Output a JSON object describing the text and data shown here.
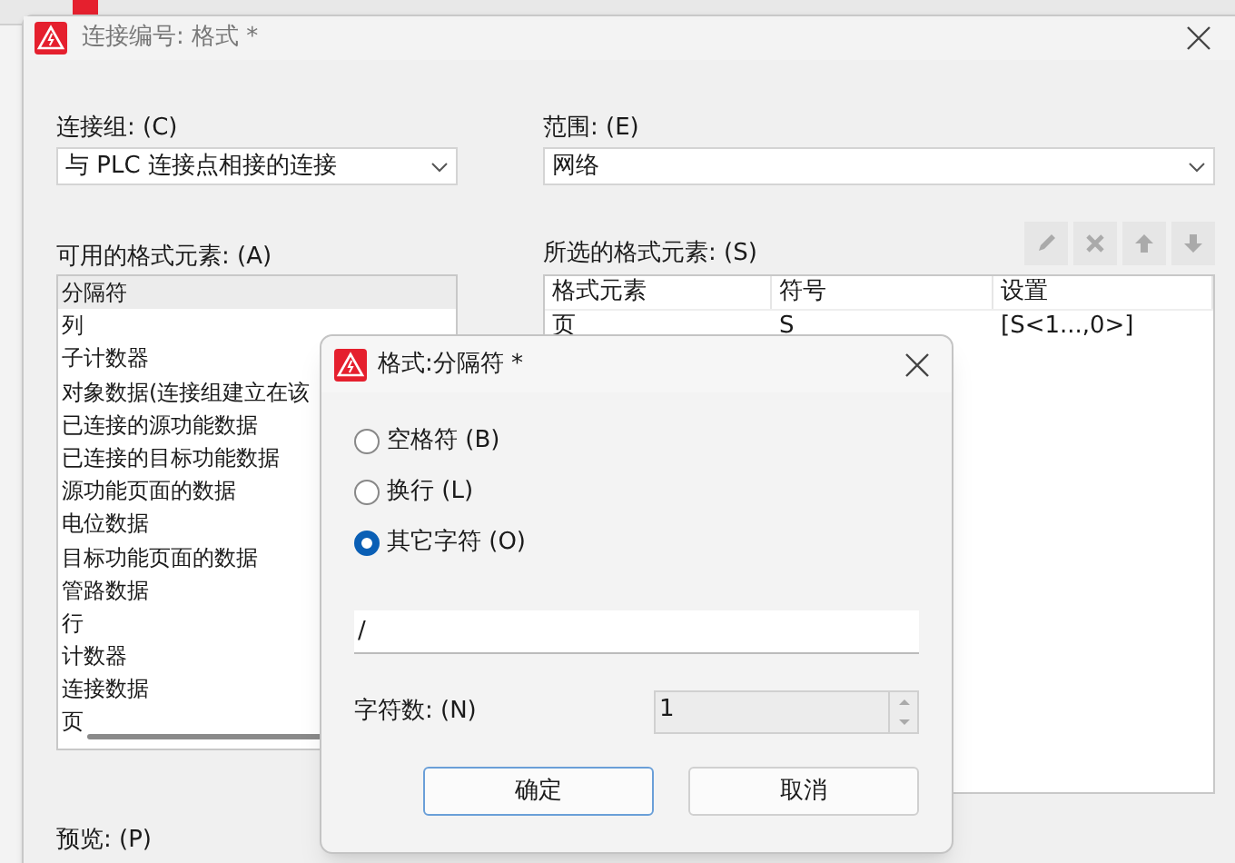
{
  "window": {
    "title": "连接编号: 格式 *"
  },
  "connection_group": {
    "label": "连接组: (C)",
    "value": "与 PLC 连接点相接的连接"
  },
  "scope": {
    "label": "范围: (E)",
    "value": "网络"
  },
  "available": {
    "label": "可用的格式元素: (A)",
    "items": [
      {
        "text": "分隔符",
        "selected": true
      },
      {
        "text": "列",
        "selected": false
      },
      {
        "text": "子计数器",
        "selected": false
      },
      {
        "text": "对象数据(连接组建立在该",
        "selected": false
      },
      {
        "text": "已连接的源功能数据",
        "selected": false
      },
      {
        "text": "已连接的目标功能数据",
        "selected": false
      },
      {
        "text": "源功能页面的数据",
        "selected": false
      },
      {
        "text": "电位数据",
        "selected": false
      },
      {
        "text": "目标功能页面的数据",
        "selected": false
      },
      {
        "text": "管路数据",
        "selected": false
      },
      {
        "text": "行",
        "selected": false
      },
      {
        "text": "计数器",
        "selected": false
      },
      {
        "text": "连接数据",
        "selected": false
      },
      {
        "text": "页",
        "selected": false
      }
    ]
  },
  "selected_elements": {
    "label": "所选的格式元素: (S)",
    "columns": [
      "格式元素",
      "符号",
      "设置"
    ],
    "rows": [
      [
        "页",
        "S",
        "[S<1...,0>]"
      ]
    ]
  },
  "preview": {
    "label": "预览: (P)"
  },
  "dialog": {
    "title": "格式:分隔符 *",
    "options": [
      {
        "label": "空格符 (B)",
        "selected": false
      },
      {
        "label": "换行 (L)",
        "selected": false
      },
      {
        "label": "其它字符 (O)",
        "selected": true
      }
    ],
    "character": {
      "value": "/"
    },
    "count": {
      "label": "字符数: (N)",
      "value": "1"
    },
    "buttons": [
      "确定",
      "取消"
    ]
  }
}
